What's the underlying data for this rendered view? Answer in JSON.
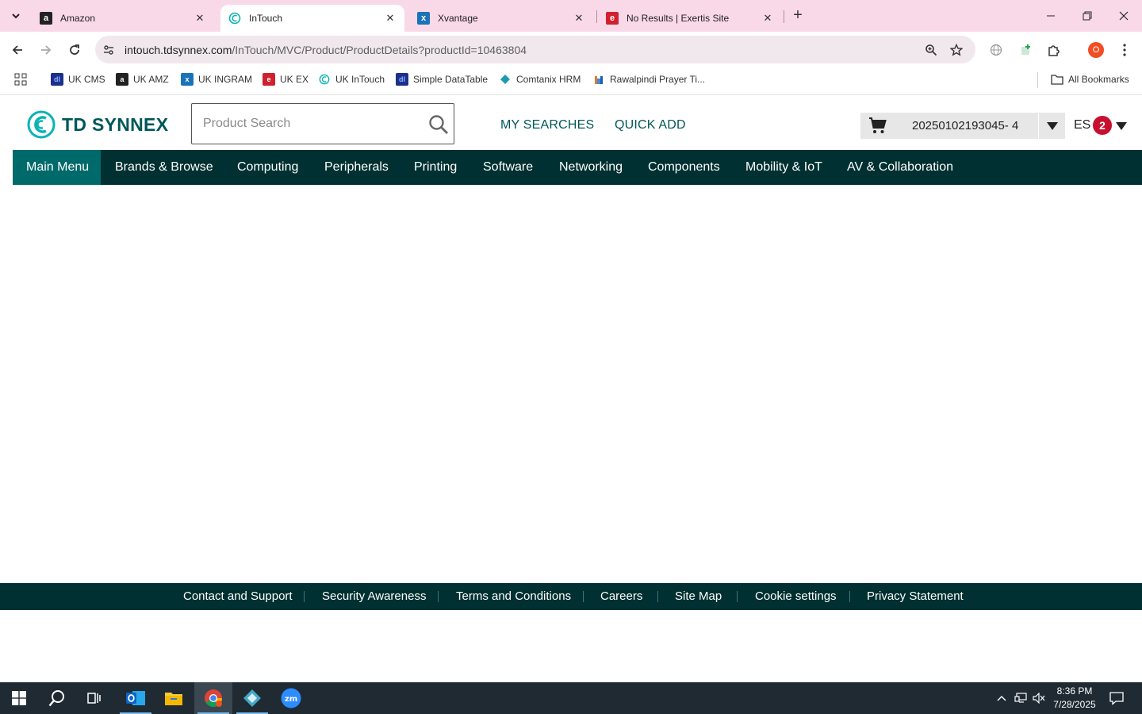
{
  "browser": {
    "tabs": [
      {
        "title": "Amazon",
        "active": false
      },
      {
        "title": "InTouch",
        "active": true
      },
      {
        "title": "Xvantage",
        "active": false
      },
      {
        "title": "No Results | Exertis Site",
        "active": false
      }
    ],
    "url_host": "intouch.tdsynnex.com",
    "url_path": "/InTouch/MVC/Product/ProductDetails?productId=10463804",
    "profile_initial": "O",
    "bookmarks": [
      {
        "label": "UK CMS"
      },
      {
        "label": "UK AMZ"
      },
      {
        "label": "UK INGRAM"
      },
      {
        "label": "UK EX"
      },
      {
        "label": "UK InTouch"
      },
      {
        "label": "Simple DataTable"
      },
      {
        "label": "Comtanix HRM"
      },
      {
        "label": "Rawalpindi Prayer Ti..."
      }
    ],
    "all_bookmarks_label": "All Bookmarks"
  },
  "site": {
    "logo_text": "TD SYNNEX",
    "search_placeholder": "Product Search",
    "my_searches": "MY SEARCHES",
    "quick_add": "QUICK ADD",
    "cart_label": "20250102193045- 4",
    "user_initials": "ES",
    "notification_count": "2",
    "brand_color": "#005758",
    "nav_color": "#003031"
  },
  "nav": {
    "items": [
      {
        "label": "Main Menu",
        "active": true
      },
      {
        "label": "Brands & Browse"
      },
      {
        "label": "Computing"
      },
      {
        "label": "Peripherals"
      },
      {
        "label": "Printing"
      },
      {
        "label": "Software"
      },
      {
        "label": "Networking"
      },
      {
        "label": "Components"
      },
      {
        "label": "Mobility & IoT"
      },
      {
        "label": "AV & Collaboration"
      }
    ]
  },
  "footer": {
    "links": [
      {
        "label": "Contact and Support"
      },
      {
        "label": "Security Awareness"
      },
      {
        "label": "Terms and Conditions"
      },
      {
        "label": "Careers"
      },
      {
        "label": "Site Map"
      },
      {
        "label": "Cookie settings"
      },
      {
        "label": "Privacy Statement"
      }
    ]
  },
  "taskbar": {
    "time": "8:36 PM",
    "date": "7/28/2025",
    "apps": [
      "start-icon",
      "search-icon",
      "task-view-icon",
      "outlook-icon",
      "file-explorer-icon",
      "chrome-icon",
      "app-icon",
      "zoom-icon"
    ]
  }
}
